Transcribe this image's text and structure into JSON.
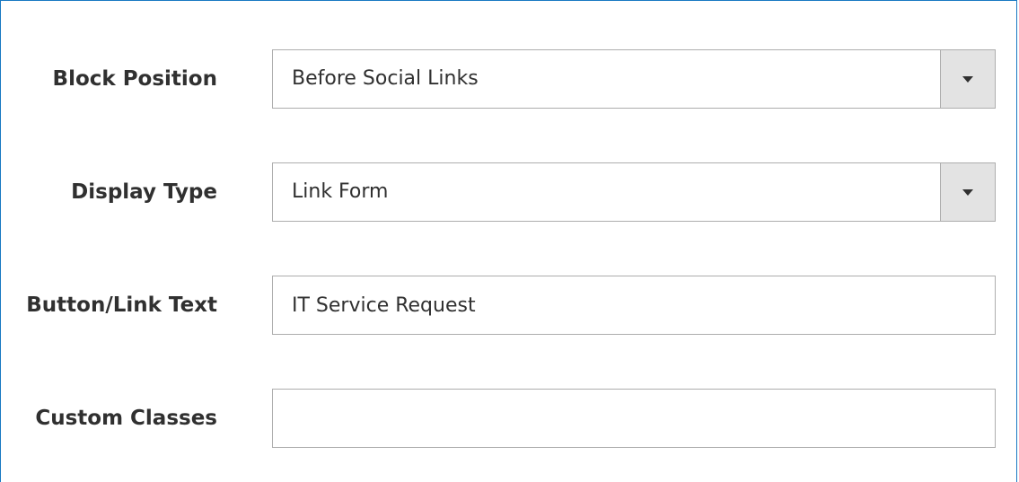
{
  "fields": {
    "block_position": {
      "label": "Block Position",
      "value": "Before Social Links"
    },
    "display_type": {
      "label": "Display Type",
      "value": "Link Form"
    },
    "button_link_text": {
      "label": "Button/Link Text",
      "value": "IT Service Request"
    },
    "custom_classes": {
      "label": "Custom Classes",
      "value": ""
    }
  },
  "icons": {
    "select_arrow": "chevron-down-icon"
  },
  "colors": {
    "frame_border": "#1979c3",
    "field_border": "#adadad",
    "select_button_bg": "#e3e3e3",
    "text": "#303030"
  }
}
